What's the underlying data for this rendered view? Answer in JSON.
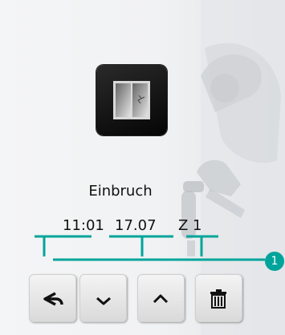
{
  "screen": {
    "event_label": "Einbruch",
    "time": "11:01",
    "date": "17.07",
    "zone": "Z 1"
  },
  "icons": {
    "event_tile": "window-intrusion-icon"
  },
  "buttons": [
    {
      "name": "back-button",
      "icon": "back-arrow-icon"
    },
    {
      "name": "scroll-down-button",
      "icon": "chevron-down-icon"
    },
    {
      "name": "scroll-up-button",
      "icon": "chevron-up-icon"
    },
    {
      "name": "delete-button",
      "icon": "trash-icon"
    }
  ],
  "callout": {
    "number": "1",
    "color": "#00a49b"
  }
}
